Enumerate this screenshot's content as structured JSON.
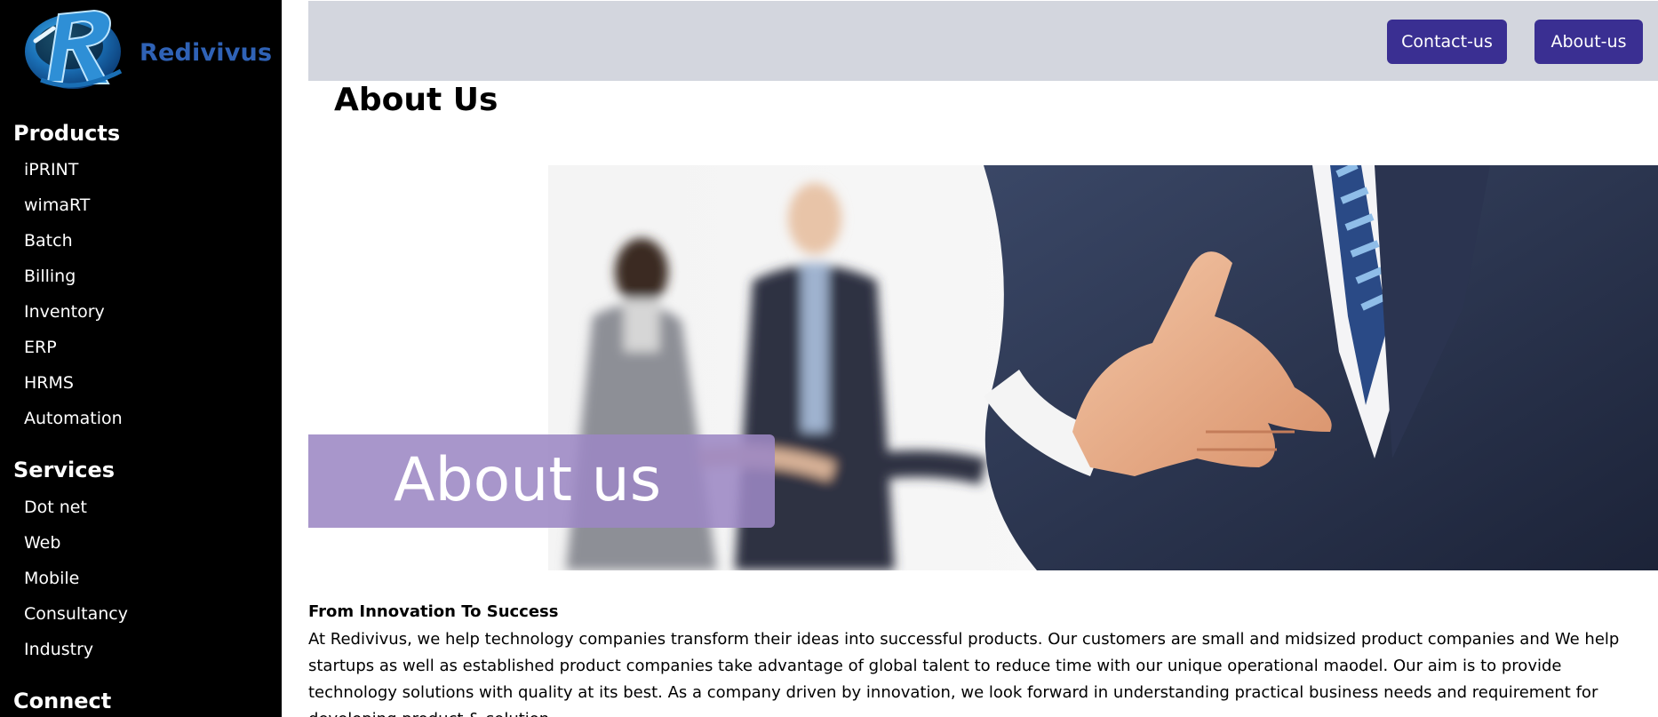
{
  "sidebar": {
    "logo_text": "Redivivus",
    "sections": [
      {
        "heading": "Products",
        "items": [
          "iPRINT",
          "wimaRT",
          "Batch",
          "Billing",
          "Inventory",
          "ERP",
          "HRMS",
          "Automation"
        ]
      },
      {
        "heading": "Services",
        "items": [
          "Dot net",
          "Web",
          "Mobile",
          "Consultancy",
          "Industry"
        ]
      },
      {
        "heading": "Connect",
        "items": []
      }
    ]
  },
  "header": {
    "contact_label": "Contact-us",
    "about_label": "About-us"
  },
  "main": {
    "page_title": "About Us",
    "hero_banner_text": "About us",
    "content_heading": "From Innovation To Success",
    "content_text": "At Redivivus, we help technology companies transform their ideas into successful products. Our customers are small and midsized product companies and We help startups as well as established product companies take advantage of global talent to reduce time with our unique operational maodel. Our aim is to provide technology solutions with quality at its best. As a company driven by innovation, we look forward in understanding practical business needs and requirement for developing product & solution."
  },
  "colors": {
    "sidebar_bg": "#000000",
    "topbar_bg": "#d3d6de",
    "button_bg": "#3a2f92",
    "logo_text": "#2f62b6",
    "banner": "#9c88c4"
  },
  "icons": {
    "logo": "redivivus-r-logo-icon"
  }
}
